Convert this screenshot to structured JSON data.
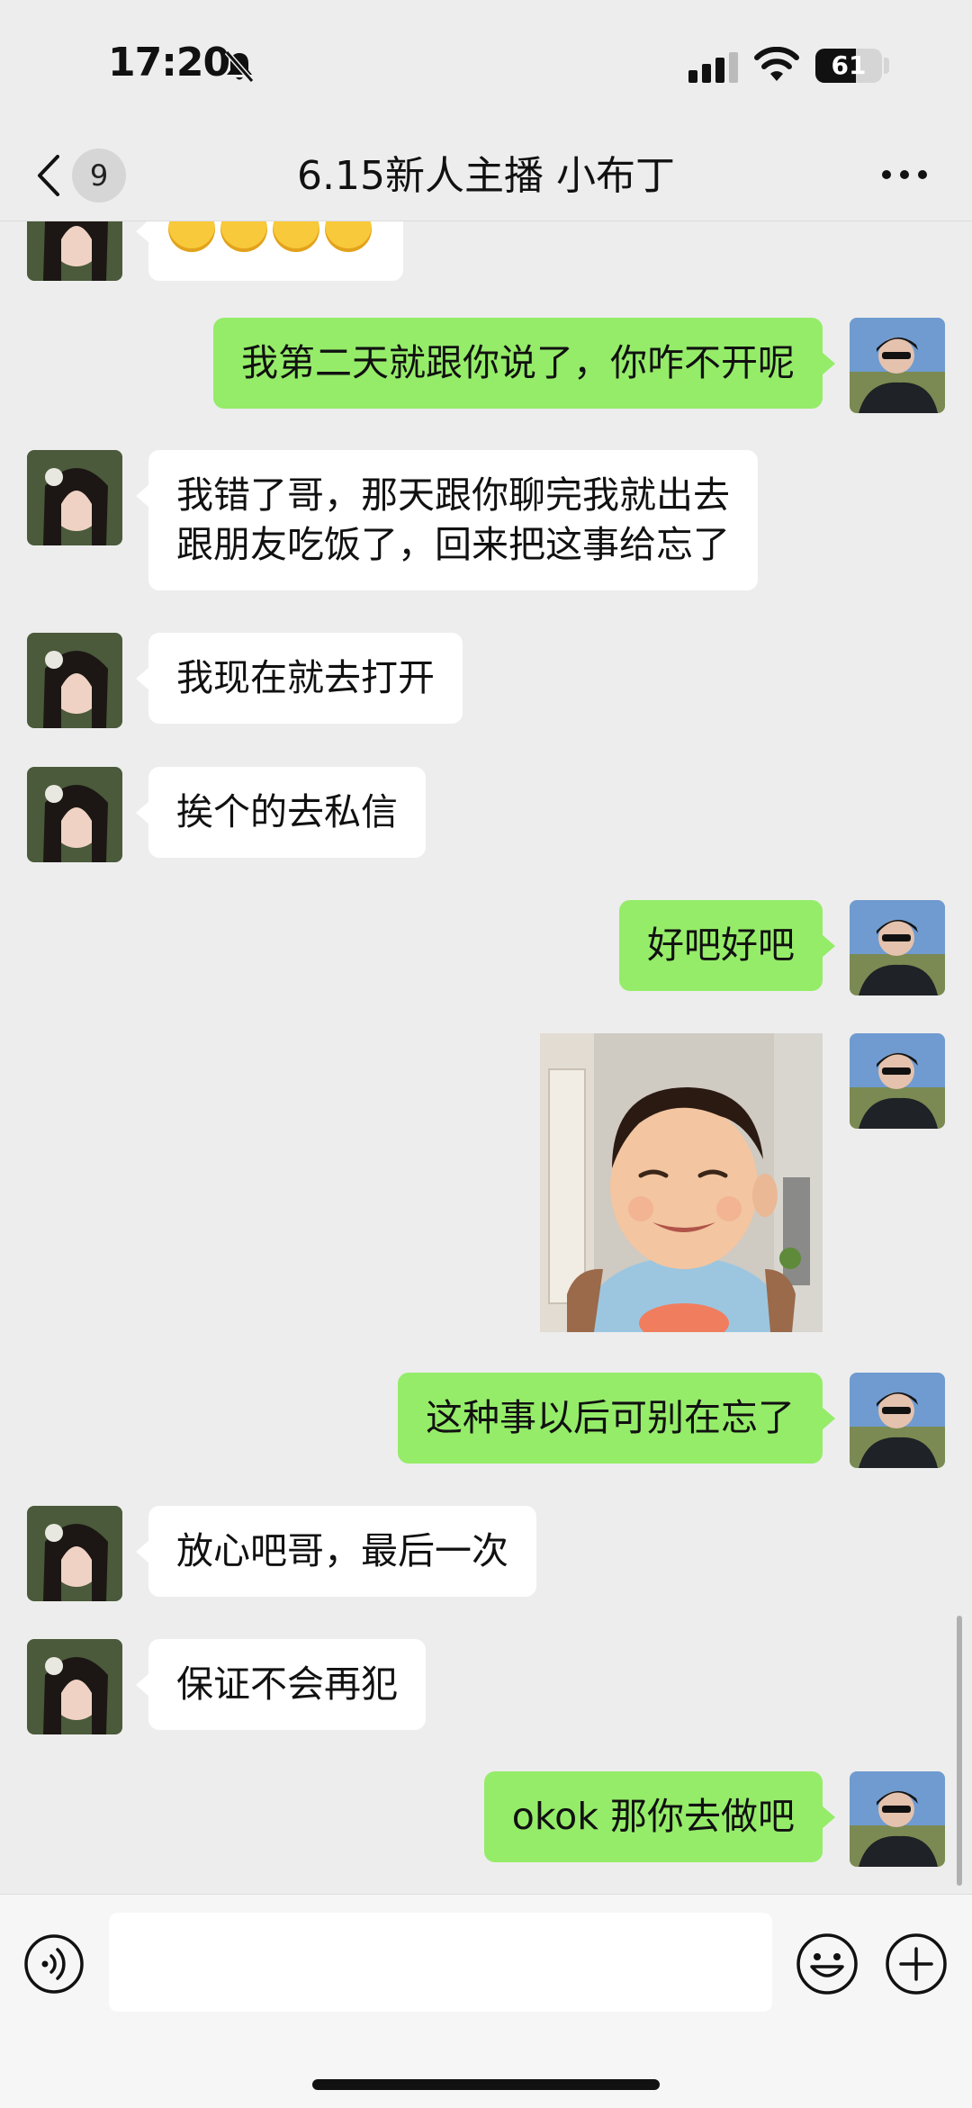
{
  "status_bar": {
    "time": "17:20",
    "battery_percent": 61,
    "battery_label": "61",
    "icons": [
      "bell-muted-icon",
      "cellular-signal-icon",
      "wifi-icon",
      "battery-icon"
    ]
  },
  "nav": {
    "back_icon": "chevron-left-icon",
    "unread_count": "9",
    "title": "6.15新人主播  小布丁",
    "more_icon": "more-dots-icon"
  },
  "colors": {
    "sent_bubble": "#95ec69",
    "received_bubble": "#ffffff",
    "background": "#ededed"
  },
  "messages": [
    {
      "sender": "them",
      "type": "emoji",
      "content": [
        "sweat-smile-emoji",
        "sweat-smile-emoji",
        "sweat-smile-emoji",
        "sweat-smile-emoji"
      ]
    },
    {
      "sender": "me",
      "type": "text",
      "text": "我第二天就跟你说了，你咋不开呢"
    },
    {
      "sender": "them",
      "type": "text",
      "text": "我错了哥，那天跟你聊完我就出去\n跟朋友吃饭了，回来把这事给忘了"
    },
    {
      "sender": "them",
      "type": "text",
      "text": "我现在就去打开"
    },
    {
      "sender": "them",
      "type": "text",
      "text": "挨个的去私信"
    },
    {
      "sender": "me",
      "type": "text",
      "text": "好吧好吧"
    },
    {
      "sender": "me",
      "type": "image",
      "content": "smiling-toddler-photo"
    },
    {
      "sender": "me",
      "type": "text",
      "text": "这种事以后可别在忘了"
    },
    {
      "sender": "them",
      "type": "text",
      "text": "放心吧哥，最后一次"
    },
    {
      "sender": "them",
      "type": "text",
      "text": "保证不会再犯"
    },
    {
      "sender": "me",
      "type": "text",
      "text": "okok 那你去做吧"
    }
  ],
  "input_bar": {
    "value": "",
    "placeholder": "",
    "icons": [
      "voice-icon",
      "emoji-icon",
      "plus-icon"
    ]
  }
}
